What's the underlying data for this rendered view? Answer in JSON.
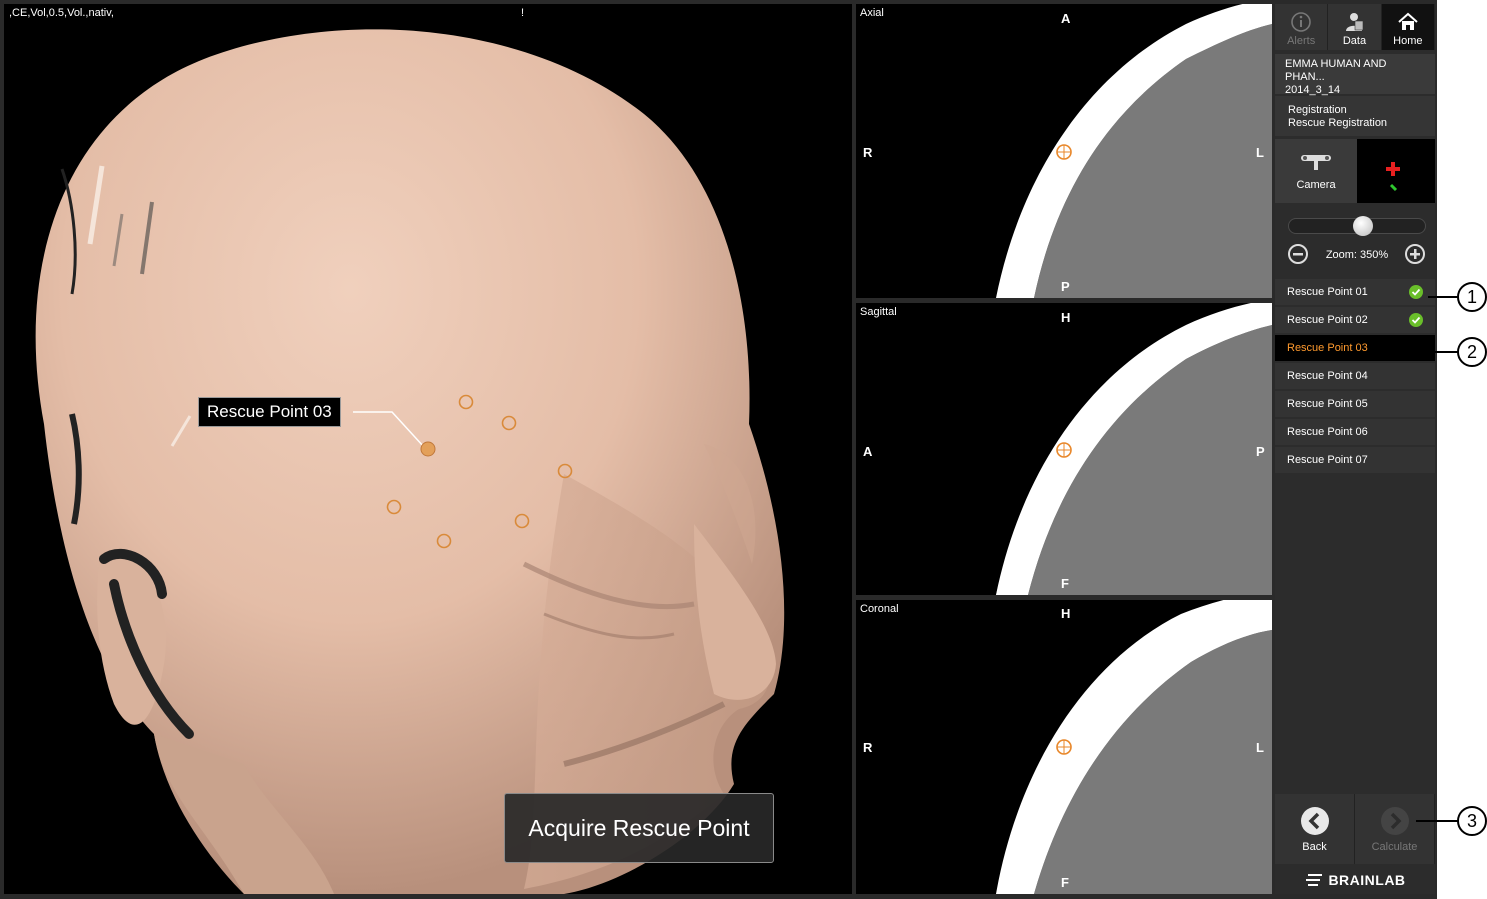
{
  "view3d": {
    "info_text": ",CE,Vol,0.5,Vol.,nativ,",
    "info_text2": "!",
    "rescue_label": "Rescue Point 03",
    "acquire_button": "Acquire Rescue Point"
  },
  "ct_views": {
    "axial": {
      "title": "Axial",
      "top": "A",
      "bottom": "P",
      "left": "R",
      "right": "L"
    },
    "sagittal": {
      "title": "Sagittal",
      "top": "H",
      "bottom": "F",
      "left": "A",
      "right": "P"
    },
    "coronal": {
      "title": "Coronal",
      "top": "H",
      "bottom": "F",
      "left": "R",
      "right": "L"
    }
  },
  "sidebar": {
    "nav": [
      {
        "label": "Alerts",
        "icon": "alerts-icon",
        "state": "disabled"
      },
      {
        "label": "Data",
        "icon": "data-icon",
        "state": "normal"
      },
      {
        "label": "Home",
        "icon": "home-icon",
        "state": "active"
      }
    ],
    "patient_name": "EMMA HUMAN AND PHAN...",
    "patient_date": "2014_3_14",
    "workflow_step": "Registration",
    "workflow_substep": "Rescue Registration",
    "camera_label": "Camera",
    "zoom_label": "Zoom: 350%",
    "zoom_level": 0.55,
    "rescue_points": [
      {
        "label": "Rescue Point 01",
        "done": true
      },
      {
        "label": "Rescue Point 02",
        "done": true
      },
      {
        "label": "Rescue Point 03",
        "done": false,
        "selected": true
      },
      {
        "label": "Rescue Point 04",
        "done": false
      },
      {
        "label": "Rescue Point 05",
        "done": false
      },
      {
        "label": "Rescue Point 06",
        "done": false
      },
      {
        "label": "Rescue Point 07",
        "done": false
      }
    ],
    "back_label": "Back",
    "calculate_label": "Calculate",
    "brand": "BRAINLAB"
  },
  "callouts": [
    "1",
    "2",
    "3"
  ],
  "colors": {
    "selected_text": "#ff9a2e",
    "check_green": "#6abf2a",
    "target_orange": "#e8872a",
    "skin": "#e8c4b0"
  }
}
